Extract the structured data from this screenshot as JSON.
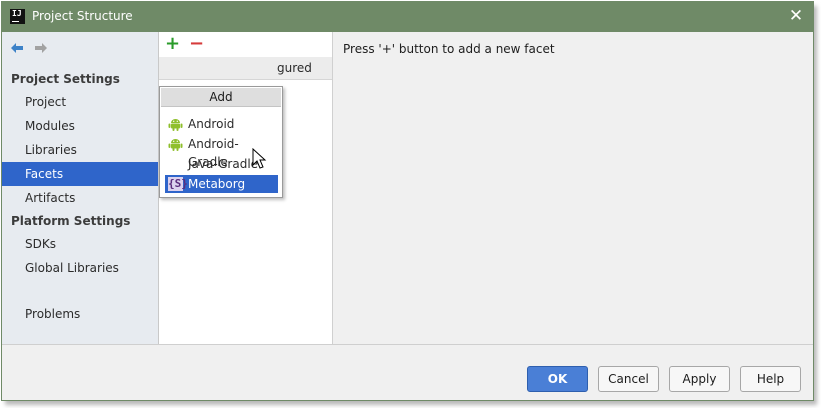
{
  "window": {
    "title": "Project Structure",
    "close_glyph": "✕"
  },
  "sidebar": {
    "sections": [
      {
        "label": "Project Settings",
        "items": [
          {
            "label": "Project",
            "selected": false
          },
          {
            "label": "Modules",
            "selected": false
          },
          {
            "label": "Libraries",
            "selected": false
          },
          {
            "label": "Facets",
            "selected": true
          },
          {
            "label": "Artifacts",
            "selected": false
          }
        ]
      },
      {
        "label": "Platform Settings",
        "items": [
          {
            "label": "SDKs",
            "selected": false
          },
          {
            "label": "Global Libraries",
            "selected": false
          }
        ]
      }
    ],
    "extra_items": [
      {
        "label": "Problems",
        "selected": false
      }
    ]
  },
  "toolbar": {
    "add_glyph": "+",
    "remove_glyph": "−"
  },
  "facet_list": {
    "header_tail": "gured"
  },
  "add_popup": {
    "title": "Add",
    "items": [
      {
        "label": "Android",
        "icon": "android-icon",
        "selected": false
      },
      {
        "label": "Android-Gradle",
        "icon": "android-icon",
        "selected": false
      },
      {
        "label": "Java-Gradle",
        "icon": "",
        "selected": false
      },
      {
        "label": "Metaborg",
        "icon": "metaborg-icon",
        "selected": true
      }
    ]
  },
  "main": {
    "hint": "Press '+' button to add a new facet"
  },
  "buttons": {
    "ok": "OK",
    "cancel": "Cancel",
    "apply": "Apply",
    "help": "Help"
  },
  "icons": {
    "metaborg_glyph": "{S}"
  },
  "colors": {
    "titlebar": "#6f8a67",
    "selection": "#2f65ca",
    "android": "#8fbf2c",
    "add": "#2a9b2a",
    "remove": "#d63b3b",
    "primary_button": "#4a7fd6"
  }
}
